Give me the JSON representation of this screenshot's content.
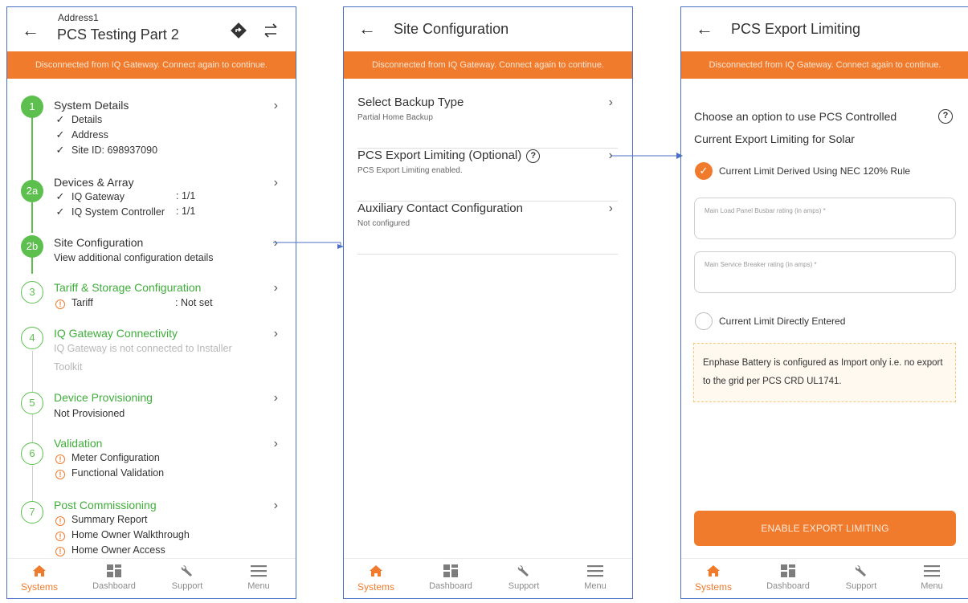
{
  "banner_text": "Disconnected from IQ Gateway. Connect again to continue.",
  "colors": {
    "accent": "#f07b2c",
    "success": "#5cbf4e",
    "frame": "#4a6fc4"
  },
  "nav": [
    {
      "label": "Systems",
      "icon": "home-icon",
      "active": true
    },
    {
      "label": "Dashboard",
      "icon": "dashboard-icon",
      "active": false
    },
    {
      "label": "Support",
      "icon": "wrench-icon",
      "active": false
    },
    {
      "label": "Menu",
      "icon": "hamburger-icon",
      "active": false
    }
  ],
  "screen1": {
    "address": "Address1",
    "title": "PCS Testing Part 2",
    "steps": [
      {
        "num": "1",
        "title": "System Details",
        "sub": [
          "Details",
          "Address",
          "Site ID: 698937090"
        ]
      },
      {
        "num": "2a",
        "title": "Devices & Array",
        "sub": [
          "IQ Gateway",
          "IQ System Controller"
        ],
        "values": [
          ": 1/1",
          ": 1/1"
        ]
      },
      {
        "num": "2b",
        "title": "Site Configuration",
        "sub": [
          "View additional configuration details"
        ]
      },
      {
        "num": "3",
        "title": "Tariff & Storage Configuration",
        "sub": [
          "Tariff"
        ],
        "values": [
          ": Not set"
        ]
      },
      {
        "num": "4",
        "title": "IQ Gateway Connectivity",
        "sub": [
          "IQ Gateway is not connected to Installer",
          "Toolkit"
        ]
      },
      {
        "num": "5",
        "title": "Device Provisioning",
        "sub": [
          "Not Provisioned"
        ]
      },
      {
        "num": "6",
        "title": "Validation",
        "sub": [
          "Meter Configuration",
          "Functional Validation"
        ]
      },
      {
        "num": "7",
        "title": "Post Commissioning",
        "sub": [
          "Summary Report",
          "Home Owner Walkthrough",
          "Home Owner Access"
        ]
      }
    ]
  },
  "screen2": {
    "title": "Site Configuration",
    "rows": [
      {
        "title": "Select Backup Type",
        "sub": "Partial Home Backup"
      },
      {
        "title": "PCS Export Limiting (Optional)",
        "sub": "PCS Export Limiting enabled."
      },
      {
        "title": "Auxiliary Contact Configuration",
        "sub": "Not configured"
      }
    ]
  },
  "screen3": {
    "title": "PCS Export Limiting",
    "choose_line1": "Choose an option to use PCS Controlled",
    "choose_line2": "Current Export Limiting for Solar",
    "option1": "Current Limit Derived Using NEC 120% Rule",
    "field1_placeholder": "Main Load Panel Busbar rating (in amps) *",
    "field2_placeholder": "Main Service Breaker rating (in amps) *",
    "option2": "Current Limit Directly Entered",
    "note": "Enphase Battery is configured as Import only i.e. no export to the grid per PCS CRD UL1741.",
    "button": "ENABLE EXPORT LIMITING"
  }
}
